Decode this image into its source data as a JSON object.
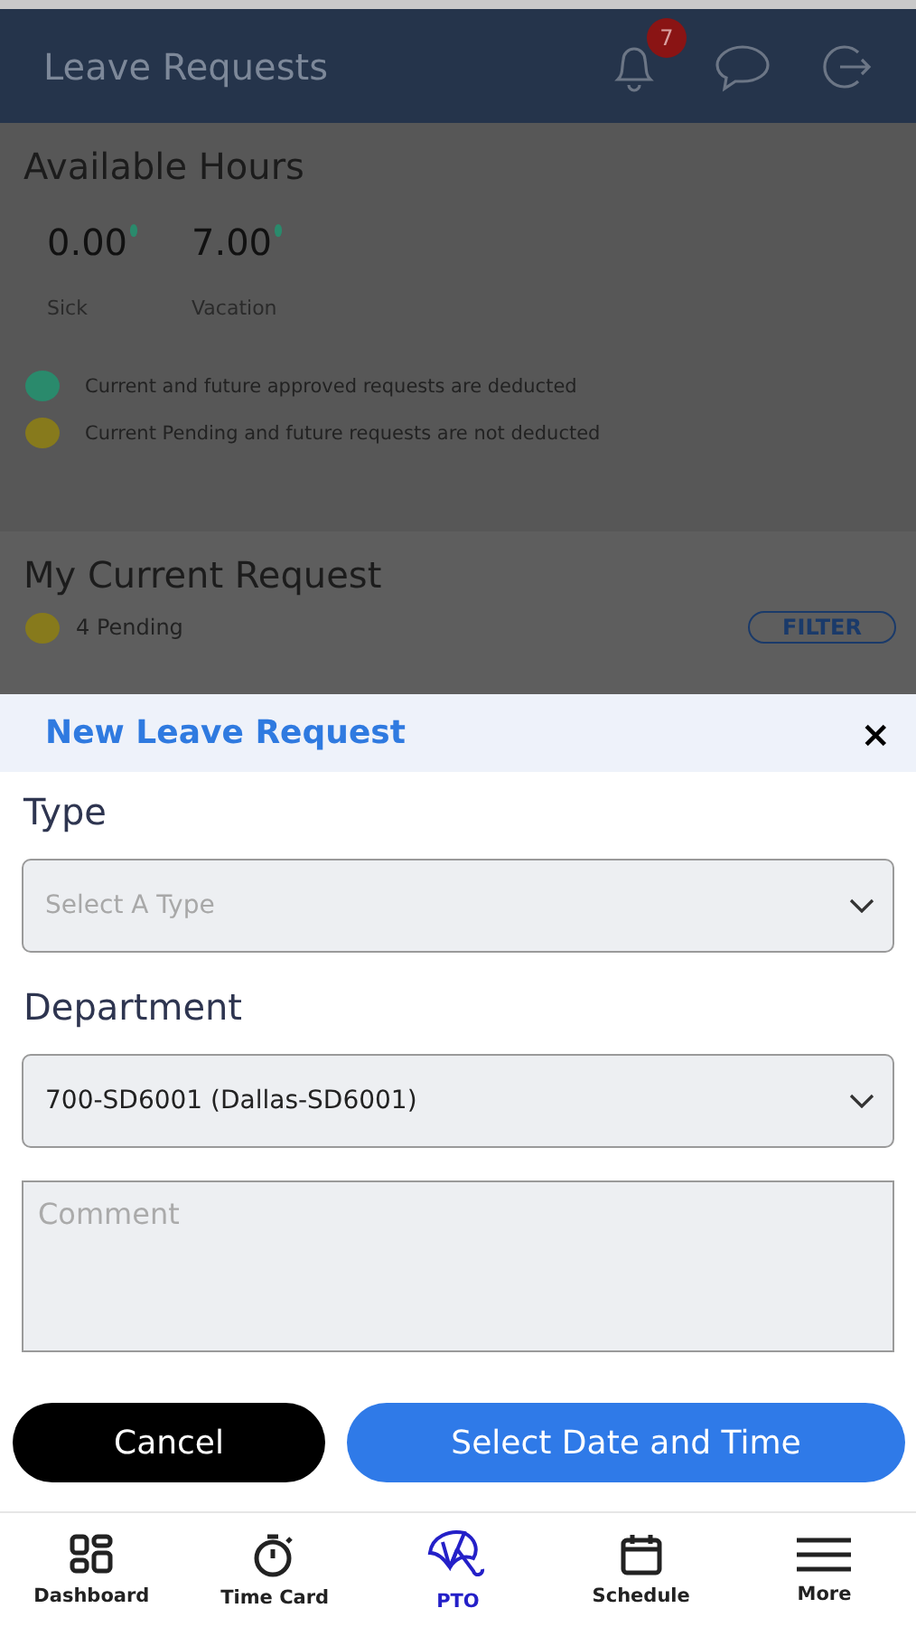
{
  "header": {
    "title": "Leave Requests",
    "notification_count": "7"
  },
  "available_hours": {
    "title": "Available Hours",
    "balances": [
      {
        "value": "0.00",
        "label": "Sick",
        "color": "#2a8a6c"
      },
      {
        "value": "7.00",
        "label": "Vacation",
        "color": "#2a8a6c"
      }
    ],
    "legend": [
      {
        "text": "Current and future approved requests are deducted",
        "color": "#2a8a6c"
      },
      {
        "text": "Current Pending and future requests are not deducted",
        "color": "#877a1c"
      }
    ]
  },
  "current_request": {
    "title": "My Current Request",
    "status": {
      "text": "4 Pending",
      "color": "#877a1c"
    },
    "filter_button": "FILTER"
  },
  "dialog": {
    "title": "New Leave Request",
    "close": "×",
    "fields": [
      {
        "label": "Type",
        "placeholder": "Select A Type"
      },
      {
        "label": "Department",
        "value": "700-SD6001 (Dallas-SD6001)"
      }
    ],
    "comment": {
      "placeholder": "Comment"
    },
    "cancel_button": "Cancel",
    "submit_button": "Select Date and Time"
  },
  "tab_bar": [
    {
      "label": "Dashboard",
      "selected": false
    },
    {
      "label": "Time Card",
      "selected": false
    },
    {
      "label": "PTO",
      "selected": true
    },
    {
      "label": "Schedule",
      "selected": false
    },
    {
      "label": "More",
      "selected": false
    }
  ]
}
